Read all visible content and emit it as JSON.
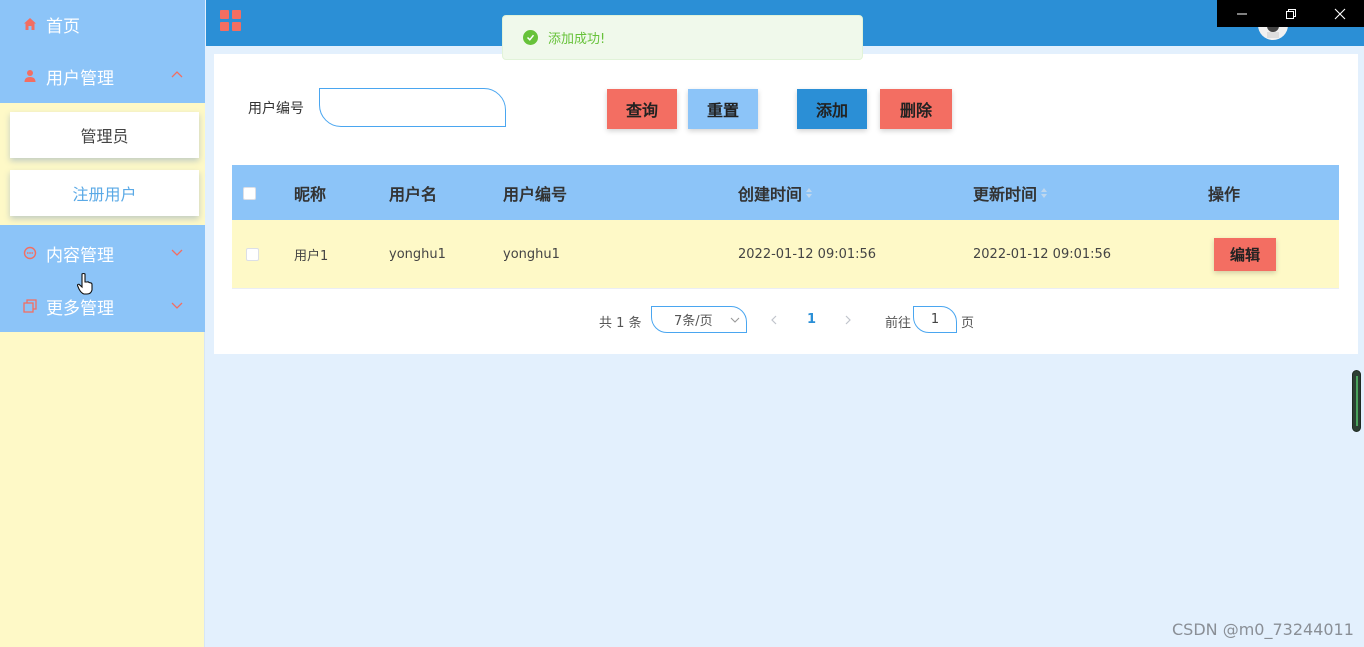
{
  "sidebar": {
    "home": "首页",
    "user_mgmt": "用户管理",
    "sub_items": [
      "管理员",
      "注册用户"
    ],
    "content_mgmt": "内容管理",
    "more_mgmt": "更多管理"
  },
  "toast": {
    "message": "添加成功!"
  },
  "search": {
    "label": "用户编号",
    "value": ""
  },
  "buttons": {
    "query": "查询",
    "reset": "重置",
    "add": "添加",
    "delete": "删除",
    "edit": "编辑"
  },
  "table": {
    "headers": [
      "昵称",
      "用户名",
      "用户编号",
      "创建时间",
      "更新时间",
      "操作"
    ],
    "rows": [
      {
        "nickname": "用户1",
        "username": "yonghu1",
        "user_no": "yonghu1",
        "created": "2022-01-12 09:01:56",
        "updated": "2022-01-12 09:01:56"
      }
    ]
  },
  "pagination": {
    "total": "共 1 条",
    "page_size": "7条/页",
    "current": "1",
    "goto_label": "前往",
    "goto_value": "1",
    "page_suffix": "页"
  },
  "watermark": "CSDN @m0_73244011",
  "colors": {
    "sidebar_menu": "#8cc4f8",
    "sidebar_bg": "#fef9c7",
    "header": "#2b8fd6",
    "query_btn": "#f36e62",
    "reset_btn": "#8cc4f8",
    "add_btn": "#2b8fd6",
    "delete_btn": "#f36e62",
    "success": "#67c23a"
  }
}
